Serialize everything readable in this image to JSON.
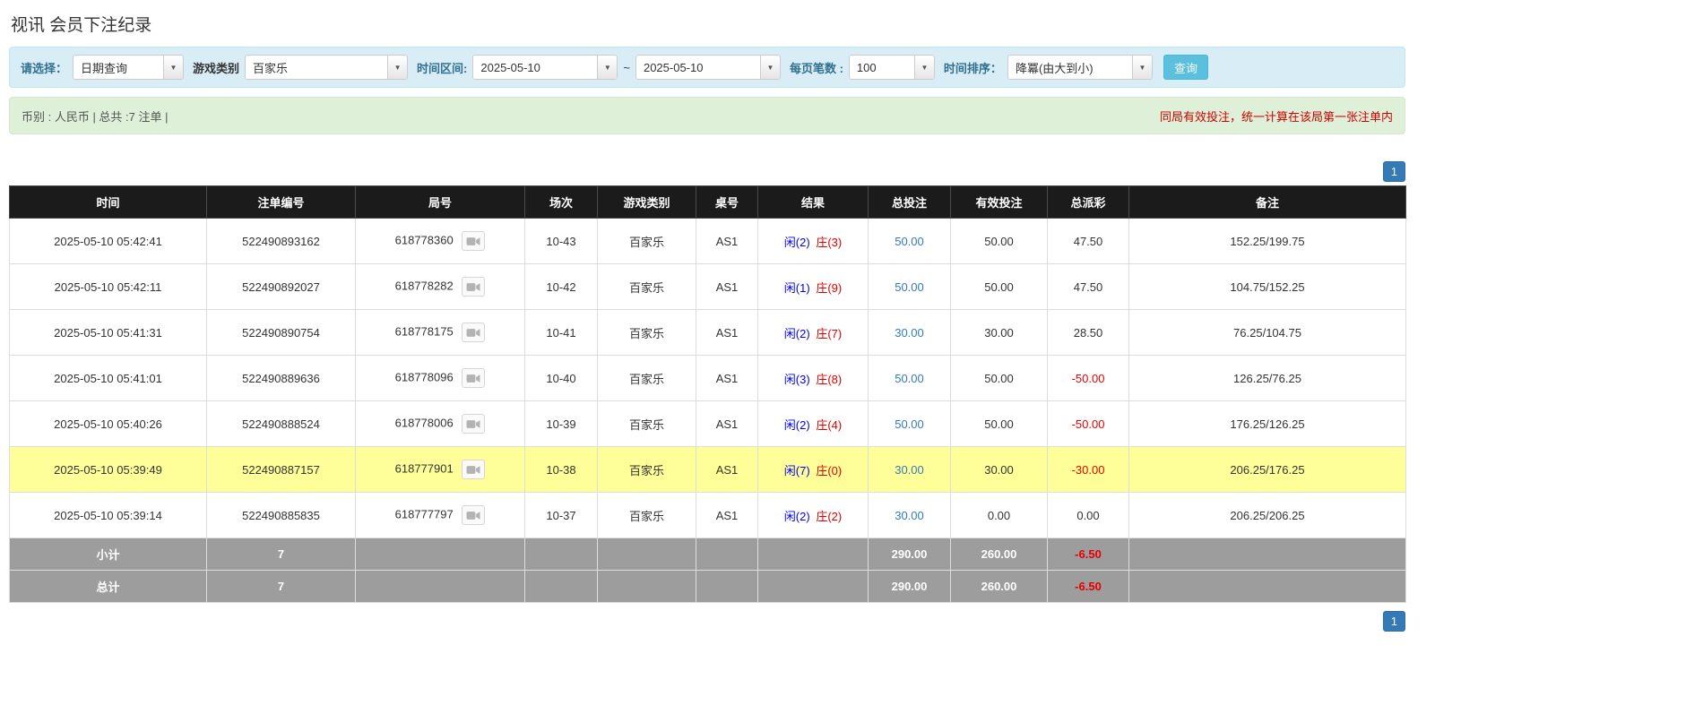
{
  "page": {
    "title": "视讯 会员下注纪录"
  },
  "filters": {
    "select_label": "请选择：",
    "select_value": "日期查询",
    "game_type_label": "游戏类别",
    "game_type_value": "百家乐",
    "date_range_label": "时间区间:",
    "date_from": "2025-05-10",
    "date_separator": "~",
    "date_to": "2025-05-10",
    "page_size_label": "每页笔数 :",
    "page_size_value": "100",
    "sort_label": "时间排序：",
    "sort_value": "降冪(由大到小)",
    "search_button_label": "查询"
  },
  "notice": {
    "left": "币别 : 人民币 | 总共 :7 注单 |",
    "right": "同局有效投注，统一计算在该局第一张注单内"
  },
  "pagination": {
    "current_page": "1"
  },
  "colors": {
    "accent_blue": "#337ab7",
    "search_cyan": "#5bc0de",
    "highlight_yellow": "#ffff99",
    "negative_red": "#e60000",
    "player_blue": "#0000ee",
    "banker_red": "#dd0000"
  },
  "table": {
    "headers": [
      "时间",
      "注单编号",
      "局号",
      "场次",
      "游戏类别",
      "桌号",
      "结果",
      "总投注",
      "有效投注",
      "总派彩",
      "备注"
    ],
    "rows": [
      {
        "time": "2025-05-10 05:42:41",
        "bet_id": "522490893162",
        "round_id": "618778360",
        "session": "10-43",
        "game": "百家乐",
        "table_no": "AS1",
        "result_player": "闲(2)",
        "result_banker": "庄(3)",
        "total_bet": "50.00",
        "valid_bet": "50.00",
        "payout": "47.50",
        "remark": "152.25/199.75",
        "highlight": false
      },
      {
        "time": "2025-05-10 05:42:11",
        "bet_id": "522490892027",
        "round_id": "618778282",
        "session": "10-42",
        "game": "百家乐",
        "table_no": "AS1",
        "result_player": "闲(1)",
        "result_banker": "庄(9)",
        "total_bet": "50.00",
        "valid_bet": "50.00",
        "payout": "47.50",
        "remark": "104.75/152.25",
        "highlight": false
      },
      {
        "time": "2025-05-10 05:41:31",
        "bet_id": "522490890754",
        "round_id": "618778175",
        "session": "10-41",
        "game": "百家乐",
        "table_no": "AS1",
        "result_player": "闲(2)",
        "result_banker": "庄(7)",
        "total_bet": "30.00",
        "valid_bet": "30.00",
        "payout": "28.50",
        "remark": "76.25/104.75",
        "highlight": false
      },
      {
        "time": "2025-05-10 05:41:01",
        "bet_id": "522490889636",
        "round_id": "618778096",
        "session": "10-40",
        "game": "百家乐",
        "table_no": "AS1",
        "result_player": "闲(3)",
        "result_banker": "庄(8)",
        "total_bet": "50.00",
        "valid_bet": "50.00",
        "payout": "-50.00",
        "remark": "126.25/76.25",
        "highlight": false
      },
      {
        "time": "2025-05-10 05:40:26",
        "bet_id": "522490888524",
        "round_id": "618778006",
        "session": "10-39",
        "game": "百家乐",
        "table_no": "AS1",
        "result_player": "闲(2)",
        "result_banker": "庄(4)",
        "total_bet": "50.00",
        "valid_bet": "50.00",
        "payout": "-50.00",
        "remark": "176.25/126.25",
        "highlight": false
      },
      {
        "time": "2025-05-10 05:39:49",
        "bet_id": "522490887157",
        "round_id": "618777901",
        "session": "10-38",
        "game": "百家乐",
        "table_no": "AS1",
        "result_player": "闲(7)",
        "result_banker": "庄(0)",
        "total_bet": "30.00",
        "valid_bet": "30.00",
        "payout": "-30.00",
        "remark": "206.25/176.25",
        "highlight": true
      },
      {
        "time": "2025-05-10 05:39:14",
        "bet_id": "522490885835",
        "round_id": "618777797",
        "session": "10-37",
        "game": "百家乐",
        "table_no": "AS1",
        "result_player": "闲(2)",
        "result_banker": "庄(2)",
        "total_bet": "30.00",
        "valid_bet": "0.00",
        "payout": "0.00",
        "remark": "206.25/206.25",
        "highlight": false
      }
    ],
    "subtotal_row": {
      "label": "小计",
      "count": "7",
      "total_bet": "290.00",
      "valid_bet": "260.00",
      "payout": "-6.50"
    },
    "total_row": {
      "label": "总计",
      "count": "7",
      "total_bet": "290.00",
      "valid_bet": "260.00",
      "payout": "-6.50"
    }
  }
}
